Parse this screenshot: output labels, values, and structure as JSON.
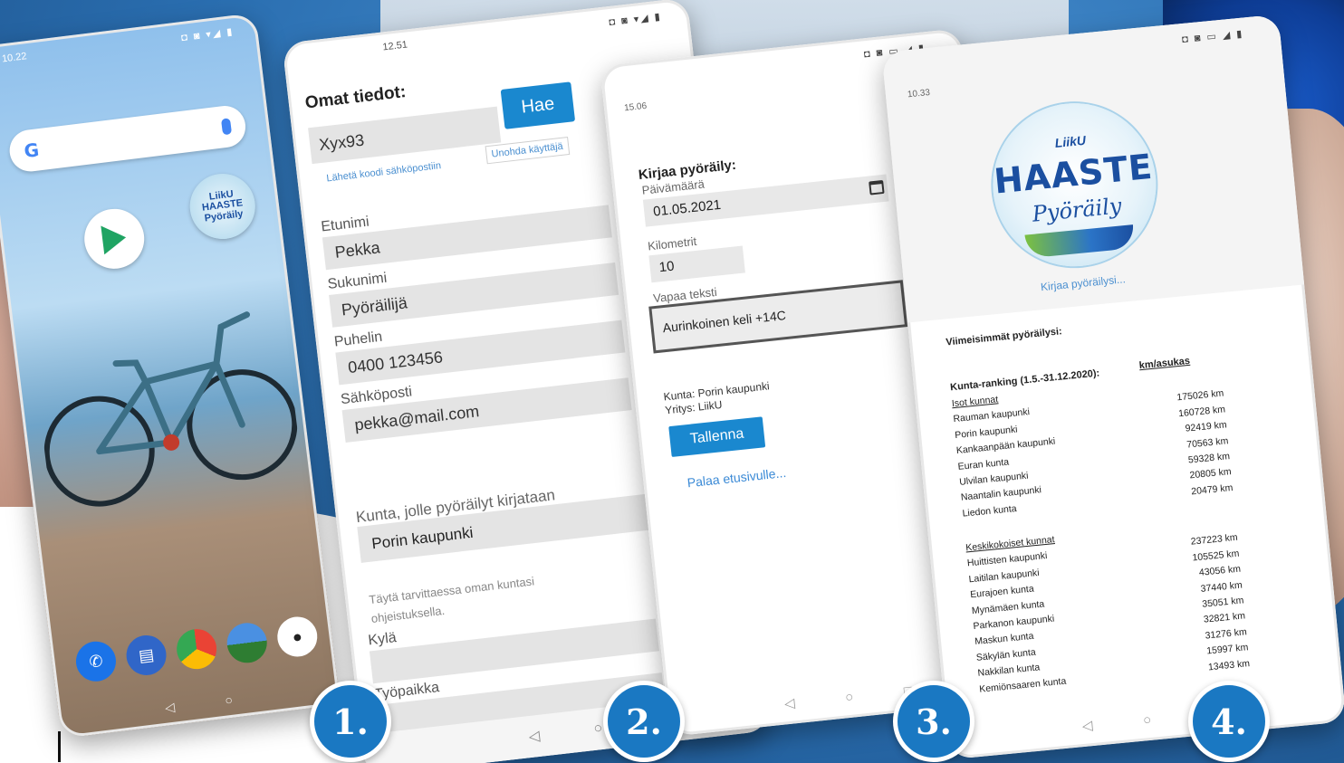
{
  "phone1": {
    "time": "10.22",
    "status_icons": "◘ ◙ ▾◢ ▮",
    "google_logo": "G",
    "app_haaste_label": "LiikU HAASTE Pyöräily",
    "nav": [
      "◁",
      "○"
    ]
  },
  "phone2": {
    "time": "12.51",
    "status_icons": "◘ ◙ ▾◢ ▮",
    "title": "Omat tiedot:",
    "username_value": "Xyx93",
    "search_button": "Hae",
    "send_code_link": "Lähetä koodi sähköpostiin",
    "forget_user_link": "Unohda käyttäjä",
    "fields": [
      {
        "label": "Etunimi",
        "value": "Pekka"
      },
      {
        "label": "Sukunimi",
        "value": "Pyöräilijä"
      },
      {
        "label": "Puhelin",
        "value": "0400 123456"
      },
      {
        "label": "Sähköposti",
        "value": "pekka@mail.com"
      }
    ],
    "municipality_label": "Kunta, jolle pyöräilyt kirjataan",
    "municipality_value": "Porin kaupunki",
    "hint": "Täytä tarvittaessa oman kuntasi ohjeistuksella.",
    "kyla_label": "Kylä",
    "kyla_value": "",
    "tyopaikka_label": "Työpaikka",
    "tyopaikka_value": "",
    "nav": [
      "◁",
      "○"
    ]
  },
  "phone3": {
    "time": "15.06",
    "status_icons": "◘ ◙ ▭ ◢ ▮",
    "title": "Kirjaa pyöräily:",
    "date_label": "Päivämäärä",
    "date_value": "01.05.2021",
    "km_label": "Kilometrit",
    "km_value": "10",
    "free_text_label": "Vapaa teksti",
    "free_text_value": "Aurinkoinen keli +14C",
    "municipality_info": "Kunta: Porin kaupunki",
    "company_info": "Yritys: LiikU",
    "save_button": "Tallenna",
    "back_link": "Palaa etusivulle...",
    "nav": [
      "◁",
      "○",
      "□"
    ]
  },
  "phone4": {
    "time": "10.33",
    "status_icons": "◘ ◙ ▭ ◢ ▮",
    "logo_top": "LiikU",
    "logo_main": "HAASTE",
    "logo_sub": "Pyöräily",
    "log_link": "Kirjaa pyöräilysi...",
    "latest_heading": "Viimeisimmät pyöräilysi:",
    "ranking_heading": "Kunta-ranking (1.5.-31.12.2020):",
    "km_heading": "km/asukas",
    "large_group": "Isot kunnat",
    "large": [
      {
        "name": "Rauman kaupunki",
        "km": "175026 km"
      },
      {
        "name": "Porin kaupunki",
        "km": "160728 km"
      },
      {
        "name": "Kankaanpään kaupunki",
        "km": "92419 km"
      },
      {
        "name": "Euran kunta",
        "km": "70563 km"
      },
      {
        "name": "Ulvilan kaupunki",
        "km": "59328 km"
      },
      {
        "name": "Naantalin kaupunki",
        "km": "20805 km"
      },
      {
        "name": "Liedon kunta",
        "km": "20479 km"
      }
    ],
    "medium_group": "Keskikokoiset kunnat",
    "medium": [
      {
        "name": "Huittisten kaupunki",
        "km": "237223 km"
      },
      {
        "name": "Laitilan kaupunki",
        "km": "105525 km"
      },
      {
        "name": "Eurajoen kunta",
        "km": "43056 km"
      },
      {
        "name": "Mynämäen kunta",
        "km": "37440 km"
      },
      {
        "name": "Parkanon kaupunki",
        "km": "35051 km"
      },
      {
        "name": "Maskun kunta",
        "km": "32821 km"
      },
      {
        "name": "Säkylän kunta",
        "km": "31276 km"
      },
      {
        "name": "Nakkilan kunta",
        "km": "15997 km"
      },
      {
        "name": "Kemiönsaaren kunta",
        "km": "13493 km"
      }
    ],
    "nav": [
      "◁",
      "○",
      "□"
    ]
  },
  "badges": [
    "1.",
    "2.",
    "3.",
    "4."
  ]
}
